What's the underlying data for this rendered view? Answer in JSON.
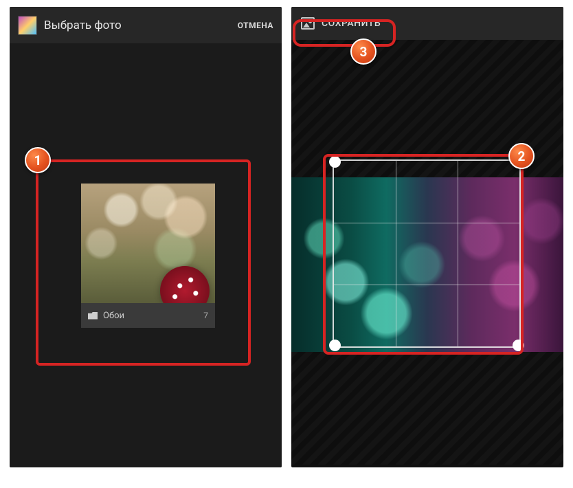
{
  "left": {
    "title": "Выбрать фото",
    "cancel": "ОТМЕНА",
    "folder": {
      "name": "Обои",
      "count": "7"
    }
  },
  "right": {
    "save": "СОХРАНИТЬ"
  },
  "annotations": {
    "badge1": "1",
    "badge2": "2",
    "badge3": "3"
  }
}
